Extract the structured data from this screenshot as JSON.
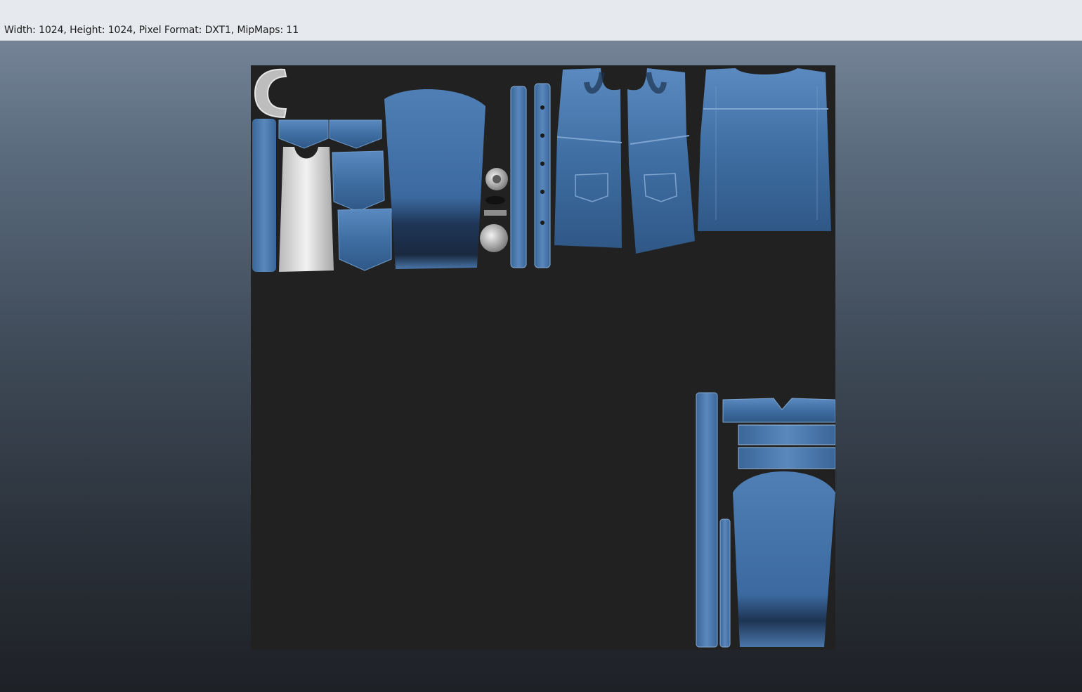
{
  "info_bar": {
    "text": "Width: 1024, Height: 1024, Pixel Format: DXT1, MipMaps: 11"
  },
  "texture": {
    "background_color": "#212121",
    "denim_color": "#3f6ea3",
    "denim_dark_color": "#1d3350",
    "tank_color": "#d9d9d9",
    "metal_color": "#b8b8b8"
  }
}
